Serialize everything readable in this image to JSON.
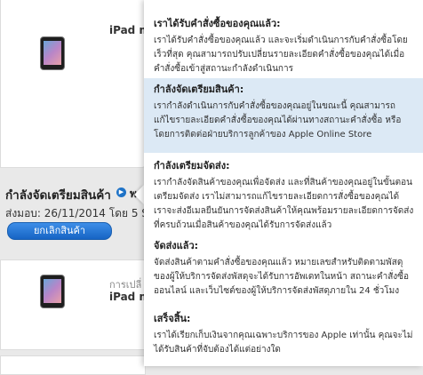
{
  "products": [
    {
      "name": "iPad mi",
      "note": ""
    },
    {
      "name": "iPad mi",
      "note": "การเปลี่"
    }
  ],
  "order": {
    "status_title": "กำลังจัดเตรียมสินค้า",
    "status_trail": "พ",
    "ship_line": "ส่งมอบ: 26/11/2014 โดย 5 Standa",
    "cancel_label": "ยกเลิกสินค้า"
  },
  "status_help": {
    "sections": [
      {
        "title": "เราได้รับคำสั่งซื้อของคุณแล้ว:",
        "body": "เราได้รับคำสั่งซื้อของคุณแล้ว และจะเริ่มดำเนินการกับคำสั่งซื้อโดยเร็วที่สุด คุณสามารถปรับเปลี่ยนรายละเอียดคำสั่งซื้อของคุณได้เมื่อคำสั่งซื้อเข้าสู่สถานะกำลังดำเนินการ",
        "highlighted": false
      },
      {
        "title": "กำลังจัดเตรียมสินค้า:",
        "body": "เรากำลังดำเนินการกับคำสั่งซื้อของคุณอยู่ในขณะนี้ คุณสามารถแก้ไขรายละเอียดคำสั่งซื้อของคุณได้ผ่านทางสถานะคำสั่งซื้อ หรือโดยการติดต่อฝ่ายบริการลูกค้าของ Apple Online Store",
        "highlighted": true
      },
      {
        "title": "กำลังเตรียมจัดส่ง:",
        "body": "เรากำลังจัดสินค้าของคุณเพื่อจัดส่ง และที่สินค้าของคุณอยู่ในขั้นตอนเตรียมจัดส่ง เราไม่สามารถแก้ไขรายละเอียดการสั่งซื้อของคุณได้ เราจะส่งอีเมลยืนยันการจัดส่งสินค้าให้คุณพร้อมรายละเอียดการจัดส่งที่ครบถ้วนเมื่อสินค้าของคุณได้รับการจัดส่งแล้ว",
        "highlighted": false
      },
      {
        "title": "จัดส่งแล้ว:",
        "body": "จัดส่งสินค้าตามคำสั่งซื้อของคุณแล้ว หมายเลขสำหรับติดตามพัสดุของผู้ให้บริการจัดส่งพัสดุจะได้รับการอัพเดทในหน้า สถานะคำสั่งซื้อออนไลน์ และเว็บไซต์ของผู้ให้บริการจัดส่งพัสดุภายใน 24 ชั่วโมง",
        "highlighted": false
      },
      {
        "title": "เสร็จสิ้น:",
        "body": "เราได้เรียกเก็บเงินจากคุณเฉพาะบริการของ Apple เท่านั้น คุณจะไม่ได้รับสินค้าที่จับต้องได้แต่อย่างใด",
        "highlighted": false
      }
    ]
  },
  "colors": {
    "accent_blue": "#1f73c7",
    "highlight_bg": "#dce9f5"
  }
}
